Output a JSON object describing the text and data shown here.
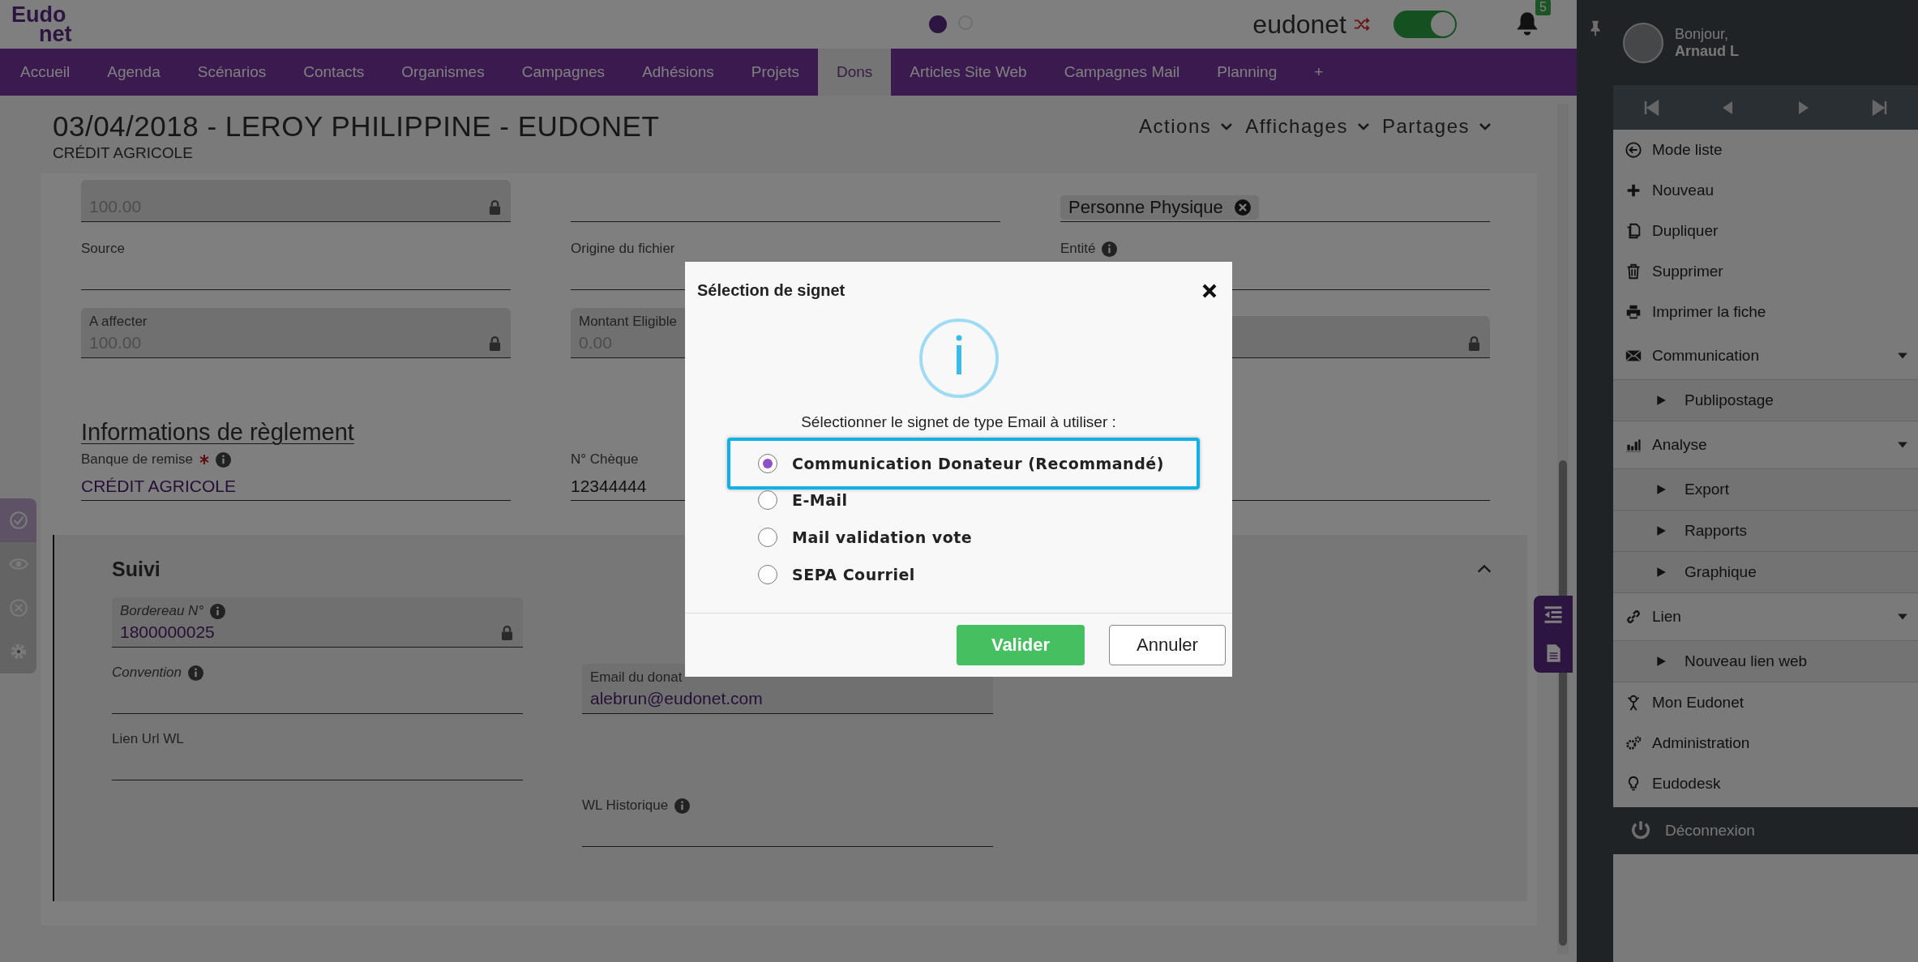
{
  "header": {
    "logo": [
      "Eudo",
      "net"
    ],
    "pager_dots": [
      {
        "selected": true
      },
      {
        "selected": false
      }
    ],
    "brand": "eudonet",
    "toggle": {
      "on": true
    },
    "notifications": "5"
  },
  "nav": [
    {
      "label": "Accueil",
      "selected": false
    },
    {
      "label": "Agenda",
      "selected": false
    },
    {
      "label": "Scénarios",
      "selected": false
    },
    {
      "label": "Contacts",
      "selected": false
    },
    {
      "label": "Organismes",
      "selected": false
    },
    {
      "label": "Campagnes",
      "selected": false
    },
    {
      "label": "Adhésions",
      "selected": false
    },
    {
      "label": "Projets",
      "selected": false
    },
    {
      "label": "Dons",
      "selected": true
    },
    {
      "label": "Articles Site Web",
      "selected": false
    },
    {
      "label": "Campagnes Mail",
      "selected": false
    },
    {
      "label": "Planning",
      "selected": false
    },
    {
      "label": "+",
      "selected": false
    }
  ],
  "record": {
    "title": "03/04/2018 - LEROY PHILIPPINE - EUDONET",
    "subtitle": "CRÉDIT AGRICOLE",
    "menus": [
      "Actions",
      "Affichages",
      "Partages"
    ]
  },
  "fields": [
    {
      "kind": "shaded",
      "locked": true,
      "disabled": true,
      "value": "100.00"
    },
    {
      "kind": "line"
    },
    {
      "kind": "chip",
      "value": "Personne Physique"
    },
    {
      "kind": "line",
      "label": "Source"
    },
    {
      "kind": "line",
      "label": "Origine du fichier"
    },
    {
      "kind": "line",
      "label": "Entité",
      "info": true
    },
    {
      "kind": "shaded",
      "locked": true,
      "label": "A affecter",
      "disabled": true,
      "value": "100.00"
    },
    {
      "kind": "shaded",
      "label": "Montant Eligible",
      "disabled": true,
      "value": "0.00"
    },
    {
      "kind": "shaded",
      "locked": true
    }
  ],
  "section": {
    "title": "Informations de règlement",
    "fields": [
      {
        "kind": "line",
        "label": "Banque de remise",
        "required": true,
        "info": true,
        "linked": true,
        "value": "CRÉDIT AGRICOLE"
      },
      {
        "kind": "line",
        "label": "N° Chèque",
        "linked": false,
        "value": "12344444"
      },
      {
        "kind": "line"
      }
    ]
  },
  "suivi": {
    "title": "Suivi",
    "expanded": true,
    "fields": [
      {
        "kind": "shaded",
        "locked": true,
        "italic": true,
        "info": true,
        "label": "Bordereau N°",
        "linked": true,
        "value": "1800000025"
      },
      {
        "kind": "blank"
      },
      {
        "kind": "line",
        "italic": true,
        "info": true,
        "label": "Convention"
      },
      {
        "kind": "shaded",
        "label": "Email du donat",
        "linked": true,
        "value": "alebrun@eudonet.com"
      },
      {
        "kind": "line",
        "label": "Lien Url WL"
      },
      {
        "kind": "blank"
      },
      {
        "kind": "blank"
      },
      {
        "kind": "line",
        "info": true,
        "label": "WL Historique"
      }
    ]
  },
  "left_toolbar": [
    {
      "selected": true
    },
    {
      "selected": false
    },
    {
      "selected": false
    },
    {
      "selected": false
    }
  ],
  "modal": {
    "title": "Sélection de signet",
    "prompt": "Sélectionner le signet de type Email à utiliser :",
    "options": [
      {
        "label": "Communication Donateur (Recommandé)",
        "selected": true,
        "highlighted": true
      },
      {
        "label": "E-Mail",
        "selected": false,
        "highlighted": false
      },
      {
        "label": "Mail validation vote",
        "selected": false,
        "highlighted": false
      },
      {
        "label": "SEPA Courriel",
        "selected": false,
        "highlighted": false
      }
    ],
    "buttons": [
      {
        "label": "Valider",
        "kind": "primary"
      },
      {
        "label": "Annuler",
        "kind": "secondary"
      }
    ]
  },
  "sidebar": {
    "greeting": "Bonjour,",
    "user": "Arnaud L",
    "menu": [
      {
        "label": "Mode liste"
      },
      {
        "label": "Nouveau"
      },
      {
        "label": "Dupliquer"
      },
      {
        "label": "Supprimer"
      },
      {
        "label": "Imprimer la fiche"
      },
      {
        "label": "Communication",
        "expanded": true,
        "children": [
          {
            "label": "Publipostage"
          }
        ]
      },
      {
        "label": "Analyse",
        "expanded": true,
        "children": [
          {
            "label": "Export"
          },
          {
            "label": "Rapports"
          },
          {
            "label": "Graphique"
          }
        ]
      },
      {
        "label": "Lien",
        "expanded": true,
        "children": [
          {
            "label": "Nouveau lien web"
          }
        ]
      },
      {
        "label": "Mon Eudonet"
      },
      {
        "label": "Administration"
      },
      {
        "label": "Eudodesk"
      }
    ],
    "logout": "Déconnexion"
  }
}
